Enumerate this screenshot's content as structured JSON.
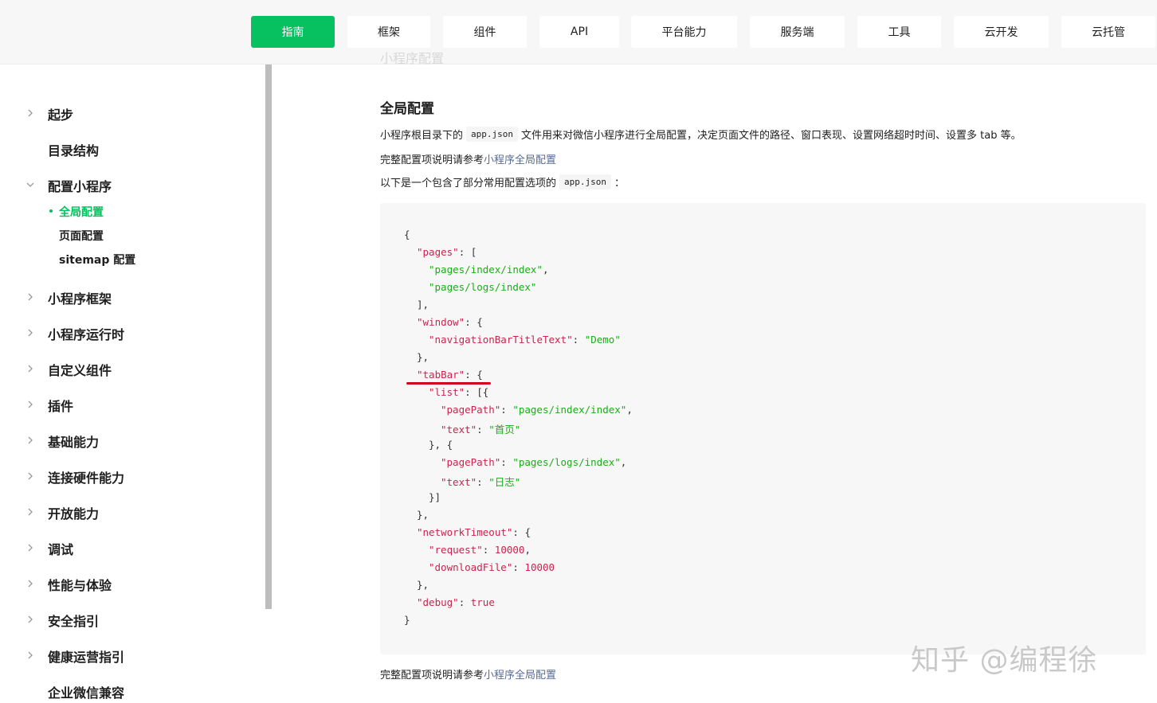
{
  "nav": {
    "tabs": [
      "指南",
      "框架",
      "组件",
      "API",
      "平台能力",
      "服务端",
      "工具",
      "云开发",
      "云托管"
    ],
    "active_index": 0
  },
  "faded_title": "小程序配置",
  "sidebar": {
    "items": {
      "start": "起步",
      "dir": "目录结构",
      "config": "配置小程序",
      "framework": "小程序框架",
      "runtime": "小程序运行时",
      "custom": "自定义组件",
      "plugin": "插件",
      "basic": "基础能力",
      "hardware": "连接硬件能力",
      "open": "开放能力",
      "debug": "调试",
      "perf": "性能与体验",
      "safety": "安全指引",
      "health": "健康运营指引",
      "wecom": "企业微信兼容"
    },
    "subitems": {
      "global": "全局配置",
      "page": "页面配置",
      "sitemap": "sitemap 配置"
    }
  },
  "main": {
    "heading": "全局配置",
    "p1_before": "小程序根目录下的",
    "p1_code": "app.json",
    "p1_after": "文件用来对微信小程序进行全局配置，决定页面文件的路径、窗口表现、设置网络超时时间、设置多 tab 等。",
    "p2_text": "完整配置项说明请参考",
    "p2_link": "小程序全局配置",
    "p3_before": "以下是一个包含了部分常用配置选项的",
    "p3_code": "app.json",
    "p3_after": "：",
    "p4_text": "完整配置项说明请参考",
    "p4_link": "小程序全局配置"
  },
  "code": {
    "t": {
      "lb": "{",
      "rb": "}",
      "lbr": "[",
      "rbr": "]",
      "c": ":",
      "cm": ",",
      "pages": "\"pages\"",
      "idx": "\"pages/index/index\"",
      "logs": "\"pages/logs/index\"",
      "window": "\"window\"",
      "navkey": "\"navigationBarTitleText\"",
      "demo": "\"Demo\"",
      "tabbar": "\"tabBar\"",
      "list": "\"list\"",
      "pagepath": "\"pagePath\"",
      "text": "\"text\"",
      "home": "\"首页\"",
      "log": "\"日志\"",
      "net": "\"networkTimeout\"",
      "req": "\"request\"",
      "dl": "\"downloadFile\"",
      "num": "10000",
      "debug": "\"debug\"",
      "true": "true",
      "close_arr_c": "],",
      "close_obj_c": "},",
      "open_list": "[{",
      "mid": "}, {",
      "close_list": "}]"
    }
  },
  "watermark": "知乎 @编程徐"
}
